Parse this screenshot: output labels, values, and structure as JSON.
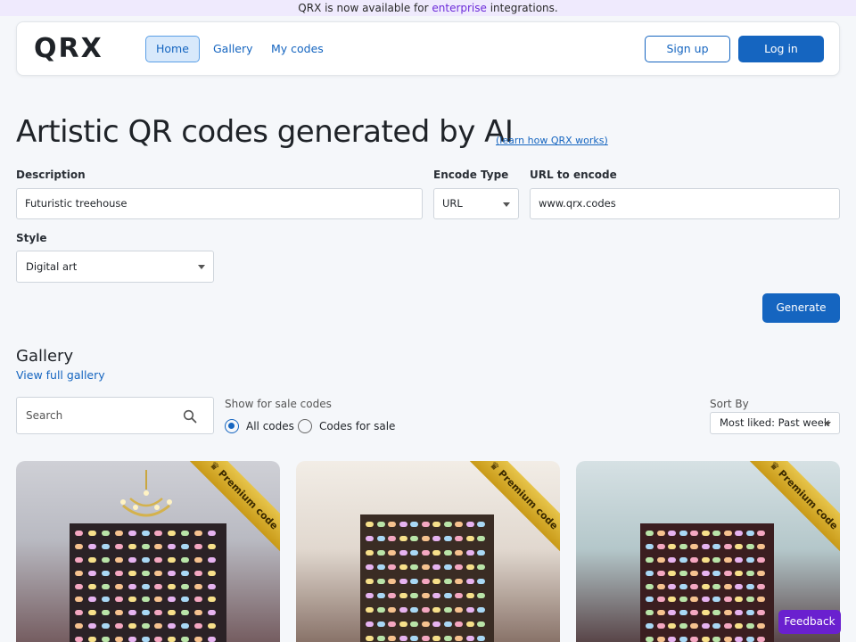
{
  "banner": {
    "prefix": "QRX is now available for ",
    "highlight": "enterprise",
    "suffix": " integrations."
  },
  "nav": {
    "logo": "QRX",
    "links": [
      {
        "label": "Home",
        "active": true
      },
      {
        "label": "Gallery",
        "active": false
      },
      {
        "label": "My codes",
        "active": false
      }
    ],
    "signup": "Sign up",
    "login": "Log in"
  },
  "hero": {
    "title": "Artistic QR codes generated by AI",
    "learn_link": "(learn how QRX works)"
  },
  "form": {
    "description_label": "Description",
    "description_value": "Futuristic treehouse",
    "encode_type_label": "Encode Type",
    "encode_type_value": "URL",
    "url_label": "URL to encode",
    "url_value": "www.qrx.codes",
    "style_label": "Style",
    "style_value": "Digital art",
    "generate": "Generate"
  },
  "gallery": {
    "title": "Gallery",
    "view_full": "View full gallery",
    "search_placeholder": "Search",
    "forsale_label": "Show for sale codes",
    "radio_all": "All codes",
    "radio_sale": "Codes for sale",
    "sort_label": "Sort By",
    "sort_value": "Most liked: Past week",
    "cards": [
      {
        "ribbon": "Premium code"
      },
      {
        "ribbon": "Premium code"
      },
      {
        "ribbon": "Premium code"
      }
    ]
  },
  "feedback": "Feedback",
  "colors": {
    "accent": "#1565c0",
    "banner_bg": "#efeafd",
    "feedback": "#6a20cf",
    "ribbon": "#d4a72c"
  }
}
